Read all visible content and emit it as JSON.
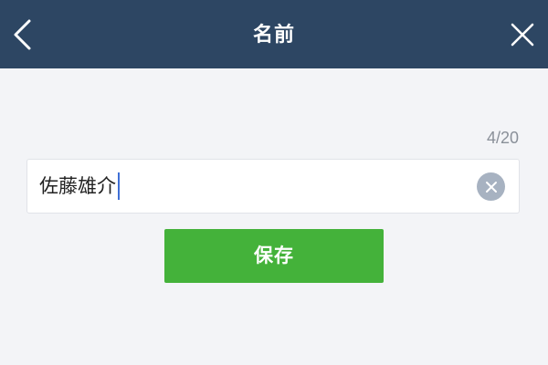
{
  "header": {
    "title": "名前",
    "back_icon": "chevron-left-icon",
    "close_icon": "close-icon",
    "background_color": "#2d4663"
  },
  "name_field": {
    "value": "佐藤雄介",
    "counter": "4/20",
    "clear_icon": "clear-circle-icon"
  },
  "actions": {
    "save_label": "保存",
    "save_color": "#44b23a"
  }
}
